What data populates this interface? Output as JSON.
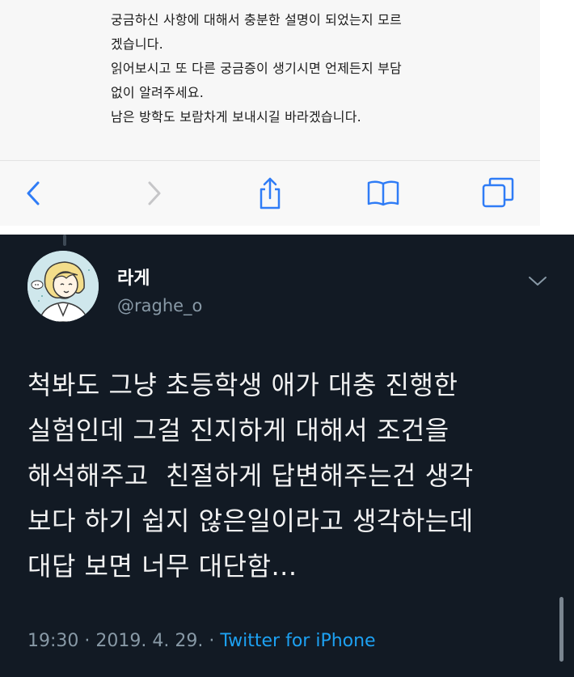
{
  "safari_page": {
    "lines": [
      "궁금하신 사항에 대해서 충분한 설명이 되었는지 모르",
      "겠습니다.",
      "읽어보시고 또 다른 궁금증이 생기시면 언제든지 부담",
      "없이 알려주세요.",
      "남은 방학도 보람차게 보내시길 바라겠습니다."
    ]
  },
  "toolbar": {
    "icons": [
      "back-icon",
      "forward-icon",
      "share-icon",
      "bookmarks-icon",
      "tabs-icon"
    ]
  },
  "tweet": {
    "display_name": "라게",
    "handle": "@raghe_o",
    "body_lines": [
      "척봐도 그냥 초등학생 애가 대충 진행한",
      "실험인데 그걸 진지하게 대해서 조건을",
      "해석해주고  친절하게 답변해주는건 생각",
      "보다 하기 쉽지 않은일이라고 생각하는데",
      "대답 보면 너무 대단함..."
    ],
    "time": "19:30",
    "date": "2019. 4. 29.",
    "separator": "·",
    "source": "Twitter for iPhone"
  },
  "colors": {
    "tweet_background": "#121a24",
    "link_blue": "#1da1f2",
    "muted_gray": "#8899a6",
    "safari_icon_blue": "#2f7cf6"
  }
}
